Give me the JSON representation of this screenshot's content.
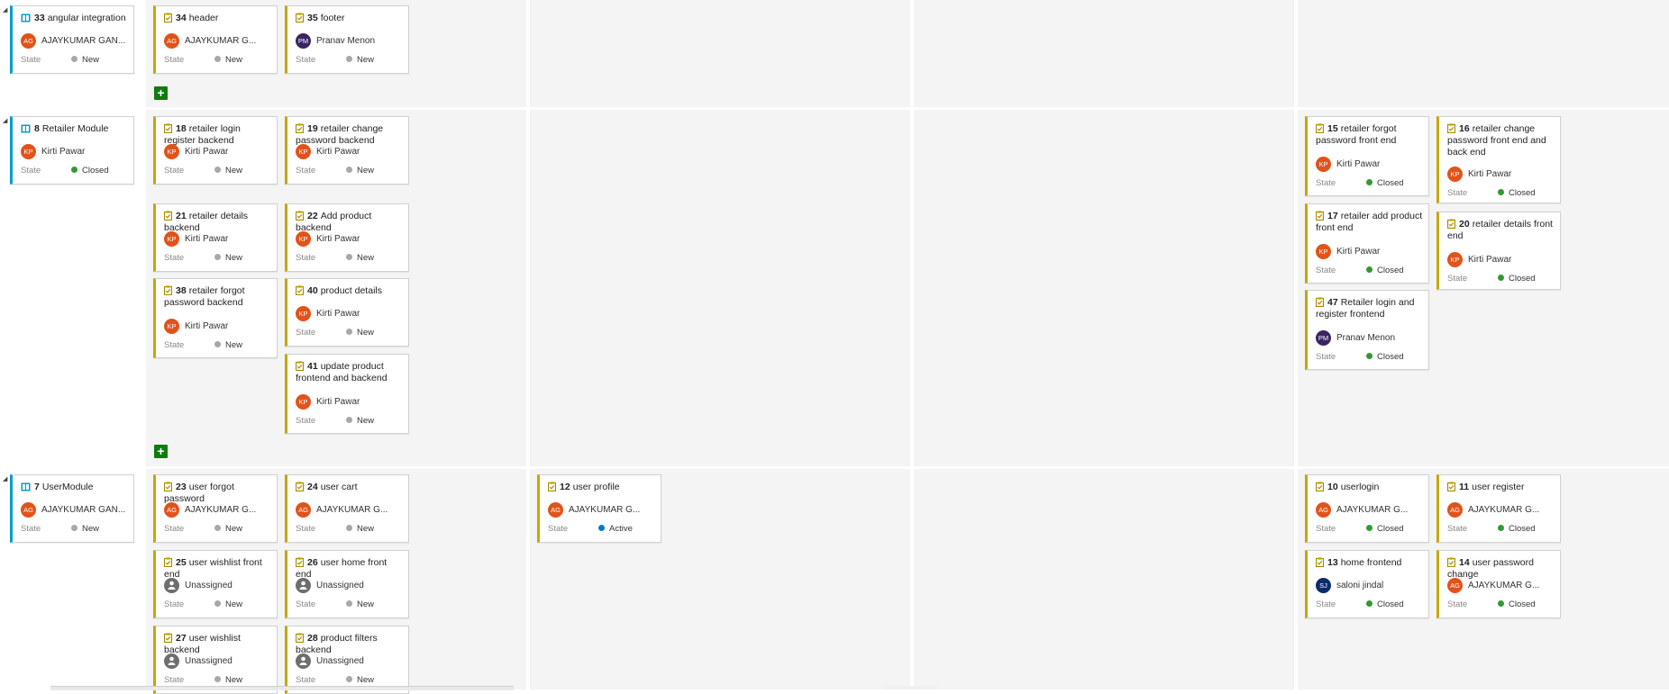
{
  "colors": {
    "task_border": "#c5a800",
    "story_border": "#009ccc",
    "state_new": "#a8a8a8",
    "state_closed": "#339933",
    "state_active": "#007acc",
    "add_button": "#107c10",
    "avatar_orange": "#e1531a",
    "avatar_purple": "#3b2464",
    "avatar_navy": "#0b2b6b",
    "avatar_unassigned": "#6e6e6e"
  },
  "labels": {
    "state": "State",
    "add": "+"
  },
  "rows": [
    {
      "name": "angular",
      "parent": {
        "id": "33",
        "title": "angular integration",
        "assignee": "AJAYKUMAR GAN...",
        "initials": "AG",
        "avatar": "orange",
        "state": "New"
      },
      "cards": [
        {
          "id": "34",
          "title": "header",
          "assignee": "AJAYKUMAR G...",
          "initials": "AG",
          "avatar": "orange",
          "state": "New"
        },
        {
          "id": "35",
          "title": "footer",
          "assignee": "Pranav Menon",
          "initials": "PM",
          "avatar": "purple",
          "state": "New"
        }
      ]
    },
    {
      "name": "retailer",
      "parent": {
        "id": "8",
        "title": "Retailer Module",
        "assignee": "Kirti Pawar",
        "initials": "KP",
        "avatar": "orange",
        "state": "Closed"
      },
      "cards": [
        {
          "id": "18",
          "title": "retailer login register backend",
          "assignee": "Kirti Pawar",
          "initials": "KP",
          "avatar": "orange",
          "state": "New"
        },
        {
          "id": "19",
          "title": "retailer change password backend",
          "assignee": "Kirti Pawar",
          "initials": "KP",
          "avatar": "orange",
          "state": "New"
        },
        {
          "id": "21",
          "title": "retailer details backend",
          "assignee": "Kirti Pawar",
          "initials": "KP",
          "avatar": "orange",
          "state": "New"
        },
        {
          "id": "22",
          "title": "Add product backend",
          "assignee": "Kirti Pawar",
          "initials": "KP",
          "avatar": "orange",
          "state": "New"
        },
        {
          "id": "38",
          "title": "retailer forgot password backend",
          "assignee": "Kirti Pawar",
          "initials": "KP",
          "avatar": "orange",
          "state": "New"
        },
        {
          "id": "40",
          "title": "product details",
          "assignee": "Kirti Pawar",
          "initials": "KP",
          "avatar": "orange",
          "state": "New"
        },
        {
          "id": "41",
          "title": "update product frontend and backend",
          "assignee": "Kirti Pawar",
          "initials": "KP",
          "avatar": "orange",
          "state": "New"
        },
        {
          "id": "15",
          "title": "retailer  forgot password front end",
          "assignee": "Kirti Pawar",
          "initials": "KP",
          "avatar": "orange",
          "state": "Closed"
        },
        {
          "id": "16",
          "title": "retailer change password front end and back end",
          "assignee": "Kirti Pawar",
          "initials": "KP",
          "avatar": "orange",
          "state": "Closed"
        },
        {
          "id": "17",
          "title": "retailer add product front end",
          "assignee": "Kirti Pawar",
          "initials": "KP",
          "avatar": "orange",
          "state": "Closed"
        },
        {
          "id": "20",
          "title": "retailer details  front end",
          "assignee": "Kirti Pawar",
          "initials": "KP",
          "avatar": "orange",
          "state": "Closed"
        },
        {
          "id": "47",
          "title": "Retailer login and register frontend",
          "assignee": "Pranav Menon",
          "initials": "PM",
          "avatar": "purple",
          "state": "Closed"
        }
      ]
    },
    {
      "name": "user",
      "parent": {
        "id": "7",
        "title": "UserModule",
        "assignee": "AJAYKUMAR GAN...",
        "initials": "AG",
        "avatar": "orange",
        "state": "New"
      },
      "cards": [
        {
          "id": "23",
          "title": "user forgot password",
          "assignee": "AJAYKUMAR G...",
          "initials": "AG",
          "avatar": "orange",
          "state": "New"
        },
        {
          "id": "24",
          "title": "user cart",
          "assignee": "AJAYKUMAR G...",
          "initials": "AG",
          "avatar": "orange",
          "state": "New"
        },
        {
          "id": "12",
          "title": "user profile",
          "assignee": "AJAYKUMAR G...",
          "initials": "AG",
          "avatar": "orange",
          "state": "Active"
        },
        {
          "id": "10",
          "title": "userlogin",
          "assignee": "AJAYKUMAR G...",
          "initials": "AG",
          "avatar": "orange",
          "state": "Closed"
        },
        {
          "id": "11",
          "title": "user register",
          "assignee": "AJAYKUMAR G...",
          "initials": "AG",
          "avatar": "orange",
          "state": "Closed"
        },
        {
          "id": "25",
          "title": "user wishlist front end",
          "assignee": "Unassigned",
          "initials": "",
          "avatar": "unassigned",
          "state": "New"
        },
        {
          "id": "26",
          "title": "user home front end",
          "assignee": "Unassigned",
          "initials": "",
          "avatar": "unassigned",
          "state": "New"
        },
        {
          "id": "13",
          "title": "home frontend",
          "assignee": "saloni jindal",
          "initials": "SJ",
          "avatar": "navy",
          "state": "Closed"
        },
        {
          "id": "14",
          "title": "user password change",
          "assignee": "AJAYKUMAR G...",
          "initials": "AG",
          "avatar": "orange",
          "state": "Closed"
        },
        {
          "id": "27",
          "title": "user wishlist backend",
          "assignee": "Unassigned",
          "initials": "",
          "avatar": "unassigned",
          "state": "New"
        },
        {
          "id": "28",
          "title": "product filters backend",
          "assignee": "Unassigned",
          "initials": "",
          "avatar": "unassigned",
          "state": "New"
        }
      ]
    }
  ]
}
